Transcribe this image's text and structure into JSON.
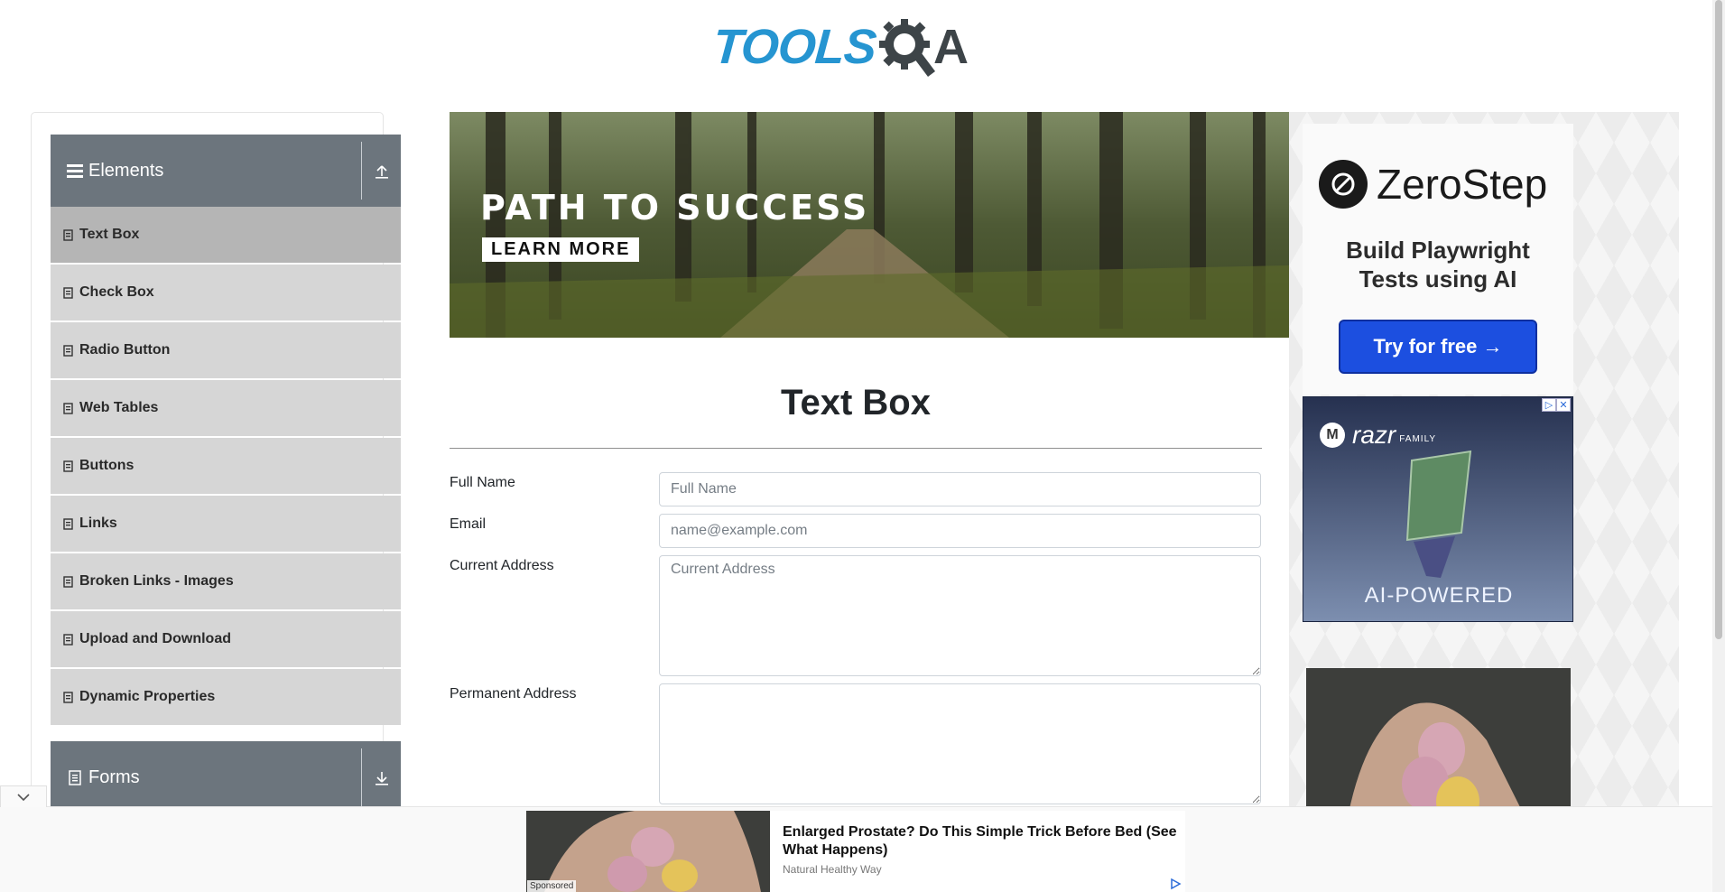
{
  "header": {
    "logo_tools": "TOOLS",
    "logo_a": "A"
  },
  "sidebar": {
    "groups": [
      {
        "label": "Elements",
        "expanded": true,
        "icon": "hamburger-icon",
        "toggle_icon": "collapse-up-icon"
      },
      {
        "label": "Forms",
        "expanded": false,
        "icon": "document-icon",
        "toggle_icon": "expand-down-icon"
      }
    ],
    "items": [
      {
        "label": "Text Box",
        "active": true
      },
      {
        "label": "Check Box",
        "active": false
      },
      {
        "label": "Radio Button",
        "active": false
      },
      {
        "label": "Web Tables",
        "active": false
      },
      {
        "label": "Buttons",
        "active": false
      },
      {
        "label": "Links",
        "active": false
      },
      {
        "label": "Broken Links - Images",
        "active": false
      },
      {
        "label": "Upload and Download",
        "active": false
      },
      {
        "label": "Dynamic Properties",
        "active": false
      }
    ]
  },
  "banner": {
    "title": "PATH TO SUCCESS",
    "cta": "LEARN MORE"
  },
  "main": {
    "title": "Text Box",
    "fields": [
      {
        "label": "Full Name",
        "placeholder": "Full Name",
        "value": ""
      },
      {
        "label": "Email",
        "placeholder": "name@example.com",
        "value": ""
      },
      {
        "label": "Current Address",
        "placeholder": "Current Address",
        "value": ""
      },
      {
        "label": "Permanent Address",
        "placeholder": "",
        "value": ""
      }
    ]
  },
  "ads": {
    "zerostep": {
      "brand": "ZeroStep",
      "tagline_1": "Build Playwright",
      "tagline_2": "Tests using AI",
      "button": "Try for free →"
    },
    "razr": {
      "brand": "razr",
      "family": "FAMILY",
      "tagline": "AI-POWERED"
    },
    "sticky": {
      "sponsored": "Sponsored",
      "title": "Enlarged Prostate? Do This Simple Trick Before Bed (See What Happens)",
      "source": "Natural Healthy Way"
    }
  },
  "colors": {
    "sidebar_header": "#6c757d",
    "menu_item": "#d6d6d6",
    "menu_item_active": "#b5b5b5",
    "logo_blue": "#2695d1",
    "zerostep_button": "#1c4fe0"
  }
}
